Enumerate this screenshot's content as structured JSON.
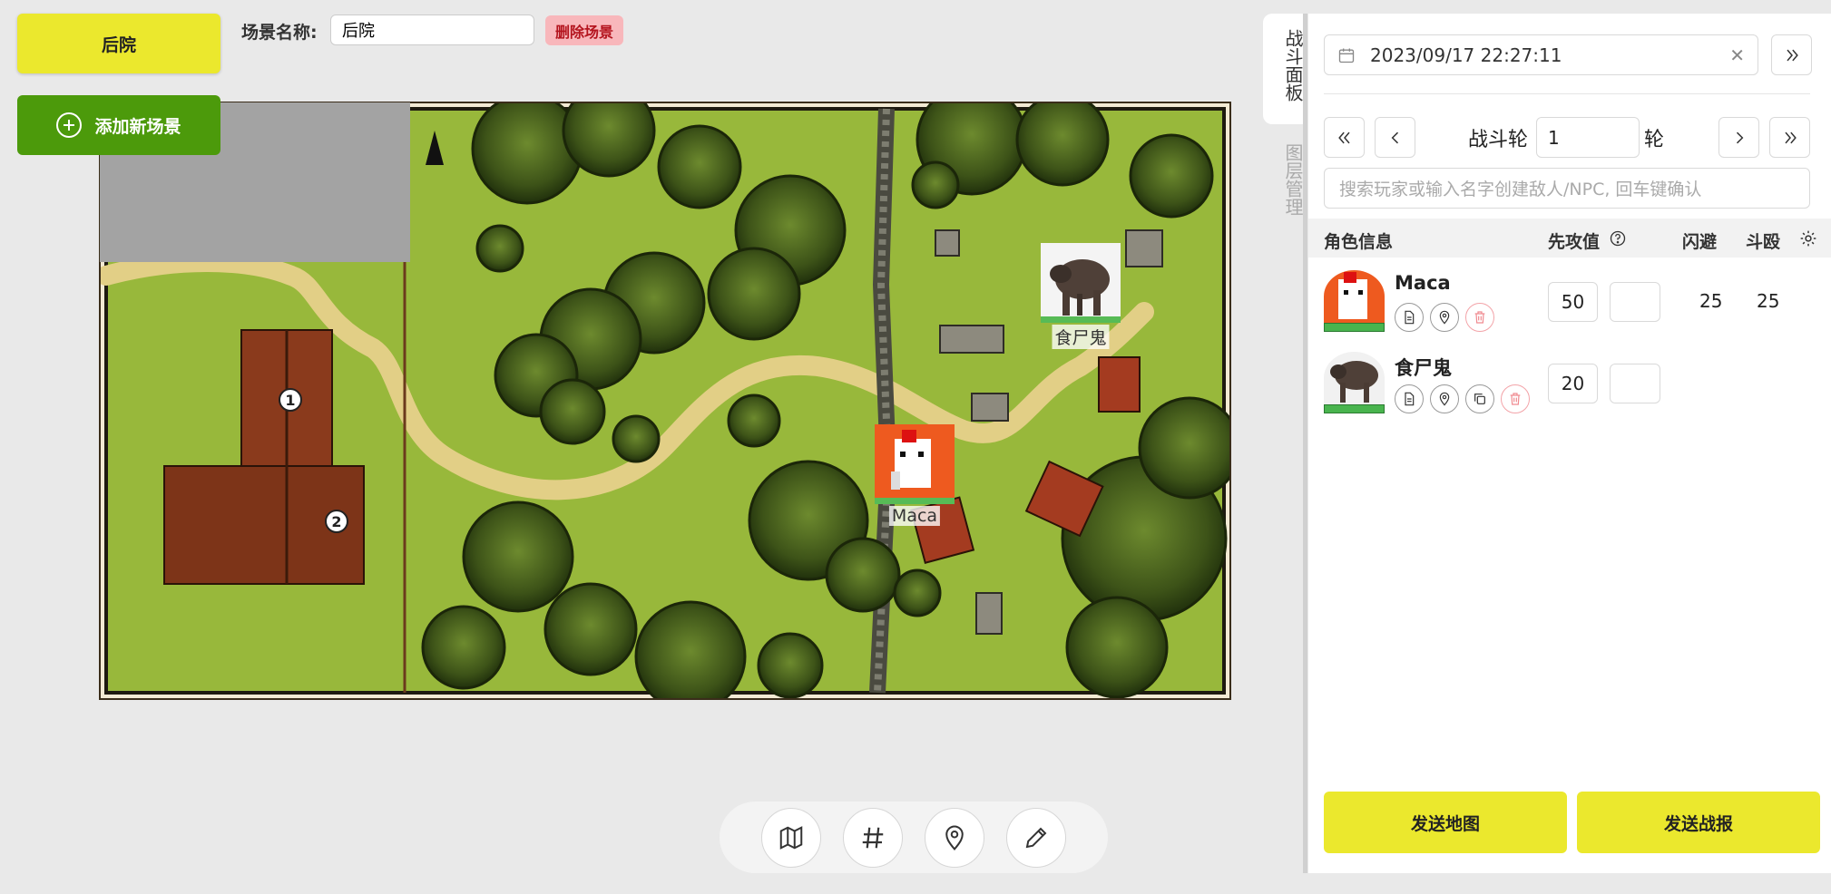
{
  "scene": {
    "active_tab": "后院",
    "add_scene_label": "添加新场景",
    "name_label": "场景名称:",
    "name_value": "后院",
    "delete_label": "删除场景"
  },
  "map": {
    "markers": [
      "1",
      "2"
    ],
    "tokens": [
      {
        "name": "Maca"
      },
      {
        "name": "食尸鬼"
      }
    ]
  },
  "toolbar": {
    "tools": [
      "map-icon",
      "grid-icon",
      "pin-icon",
      "pencil-icon"
    ]
  },
  "side_tabs": {
    "battle": "战斗面板",
    "layers": "图层管理"
  },
  "battle": {
    "datetime": "2023/09/17 22:27:11",
    "round_label": "战斗轮",
    "round_value": "1",
    "round_suffix": "轮",
    "search_placeholder": "搜索玩家或输入名字创建敌人/NPC, 回车键确认",
    "columns": {
      "info": "角色信息",
      "initiative": "先攻值",
      "dodge": "闪避",
      "dp": "斗殴"
    },
    "rows": [
      {
        "name": "Maca",
        "initiative": "50",
        "dodge": "25",
        "dp": "25"
      },
      {
        "name": "食尸鬼",
        "initiative": "20",
        "dodge": "",
        "dp": ""
      }
    ],
    "send_map": "发送地图",
    "send_report": "发送战报"
  },
  "colors": {
    "accent_yellow": "#ebe82d",
    "accent_green": "#4c9a0b",
    "danger_bg": "#f8b7bb",
    "hp_green": "#49b44e"
  }
}
